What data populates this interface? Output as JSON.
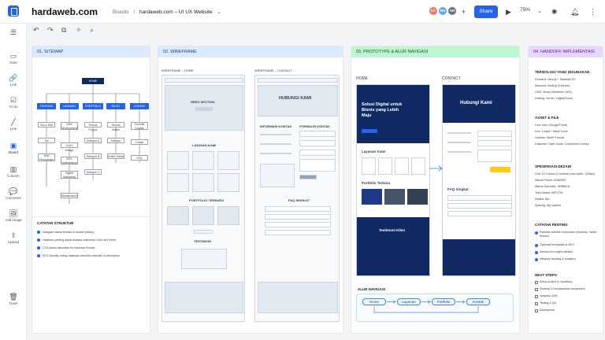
{
  "header": {
    "brand": "hardaweb.com",
    "breadcrumb_root": "Boards",
    "breadcrumb_sep": "/",
    "board_title": "hardaweb.com – UI UX Website",
    "avatars": [
      {
        "initials": "DA",
        "color": "#f97360"
      },
      {
        "initials": "RH",
        "color": "#60a5fa"
      },
      {
        "initials": "AR",
        "color": "#6b7280"
      }
    ],
    "share_label": "Share",
    "zoom": "75%"
  },
  "tools": [
    {
      "label": "Note",
      "icon": "▭"
    },
    {
      "label": "Link",
      "icon": "🔗"
    },
    {
      "label": "To-do",
      "icon": "☑"
    },
    {
      "label": "Line",
      "icon": "╱"
    },
    {
      "label": "Board",
      "icon": "▣"
    },
    {
      "label": "Column",
      "icon": "▥"
    },
    {
      "label": "Comment",
      "icon": "💬"
    },
    {
      "label": "Add image",
      "icon": "🖼"
    },
    {
      "label": "Upload",
      "icon": "⇪"
    },
    {
      "label": "Trash",
      "icon": "🗑"
    }
  ],
  "columns": {
    "sitemap": {
      "title": "01. SITEMAP",
      "root": "HOME",
      "pages": [
        "TENTANG",
        "LAYANAN",
        "PORTFOLIO",
        "BLOG",
        "KONTAK"
      ],
      "sub": {
        "tentang": [
          "Visi & Misi",
          "Tim",
          "Nilai Perusahaan"
        ],
        "layanan": [
          "Web Development",
          "UI/UX Design",
          "SEO Optimization",
          "Digital Marketing",
          "Maintenance"
        ],
        "portfolio": [
          "Semua Proyek",
          "Kategori A",
          "Kategori B",
          "Kategori C"
        ],
        "blog": [
          "Semua Artikel",
          "Kategori",
          "Artikel Detail"
        ],
        "kontak": [
          "Formulir Kontak",
          "Lokasi",
          "FAQ"
        ]
      },
      "notes_title": "CATATAN STRUKTUR",
      "notes": [
        "Navigasi utama berada di header (sticky).",
        "Halaman penting dapat diakses maksimal 3 klik dari Home.",
        "CTA utama diarahkan ke halaman Kontak.",
        "SEO friendly: setiap halaman memiliki meta title & description."
      ]
    },
    "wireframe": {
      "title": "02. WIREFRAME",
      "home_label": "WIREFRAME – HOME",
      "contact_label": "WIREFRAME – CONTACT",
      "hero": "HERO SECTION",
      "services": "LAYANAN KAMI",
      "portfolio": "PORTFOLIO TERBARU",
      "testimonial": "TESTIMONI",
      "contact_title": "HUBUNGI KAMI",
      "info": "INFORMASI KONTAK",
      "form": "FORMULIR KONTAK",
      "faq": "FAQ SINGKAT"
    },
    "prototype": {
      "title": "03. PROTOTYPE & ALUR NAVIGASI",
      "home_label": "HOME",
      "contact_label": "CONTACT",
      "hero_text": "Solusi Digital untuk Bisnis yang Lebih Maju",
      "contact_hero": "Hubungi Kami",
      "services": "Layanan Kami",
      "portfolio": "Portfolio Terbaru",
      "faq": "FAQ Singkat",
      "testimonial": "Testimoni Klien",
      "flow_title": "ALUR NAVIGASI",
      "flow": [
        "Home",
        "Layanan",
        "Portfolio",
        "Kontak"
      ]
    },
    "handoff": {
      "title": "04. HANDOFF IMPLEMENTASI",
      "tech_title": "TEKNOLOGI YANG DIGUNAKAN",
      "tech": [
        "Frontend: Next.js + TailwindCSS",
        "Backend: Node.js (Express)",
        "CMS: Strapi (Headless CMS)",
        "Hosting: Vercel / DigitalOcean"
      ],
      "assets_title": "ASSET & FILE",
      "assets": [
        "Font: Inter (Google Fonts)",
        "Icon: Lucide / Tabler Icons",
        "Gambar: WebP Format",
        "Dokumen: Style Guide, Component Library"
      ],
      "spec_title": "SPESIFIKASI DESAIN",
      "spec": [
        "Grid: 12 Column (Container max width: 1200px)",
        "Warna Primer: #2563EB",
        "Warna Sekunder: #F8B8C8",
        "Teks Utama: #0F172A",
        "Radius: 8px",
        "Spacing: 8px system"
      ],
      "notes_title": "CATATAN PENTING",
      "notes": [
        "Pastikan website responsive (Desktop, Tablet, Mobile)",
        "Optimasi kecepatan & SEO",
        "Semua form wajib validasi",
        "Integrasi tracking & analytics"
      ],
      "next_title": "NEXT STEPS",
      "next": [
        "Setup project & repository",
        "Develop UI berdasarkan component",
        "Integrasi CMS",
        "Testing & QA",
        "Deployment"
      ]
    }
  }
}
